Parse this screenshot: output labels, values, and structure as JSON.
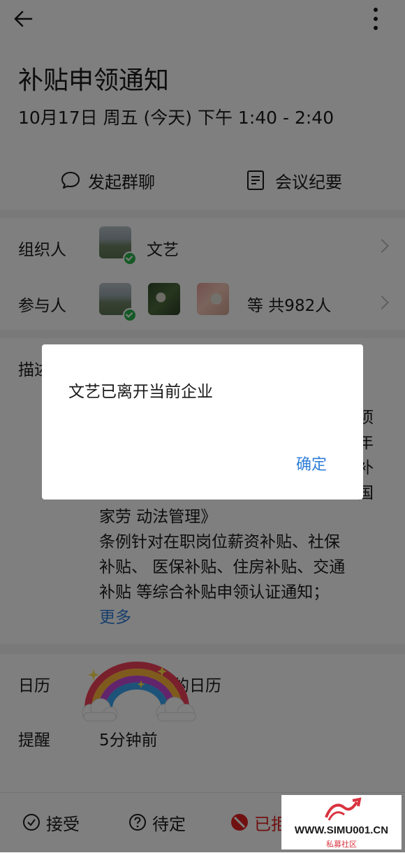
{
  "header": {
    "title": "补贴申领通知",
    "datetime": "10月17日 周五 (今天) 下午 1:40 - 2:40"
  },
  "actions": {
    "group_chat": "发起群聊",
    "minutes": "会议纪要"
  },
  "organizer": {
    "label": "组织人",
    "name": "文艺"
  },
  "participants": {
    "label": "参与人",
    "summary": "等 共982人"
  },
  "description": {
    "label_partial": "描述",
    "visible_fragments": [
      "项",
      "年",
      "补",
      "国"
    ],
    "lines": [
      "家劳 动法管理》",
      "条例针对在职岗位薪资补贴、社保",
      "补贴、 医保补贴、住房补贴、交通",
      "补贴 等综合补贴申领认证通知；"
    ],
    "more": "更多"
  },
  "calendar": {
    "label": "日历",
    "value_partial": "的日历"
  },
  "reminder": {
    "label": "提醒",
    "value": "5分钟前"
  },
  "bottom_bar": {
    "accept": "接受",
    "tentative": "待定",
    "declined": "已拒"
  },
  "dialog": {
    "message": "文艺已离开当前企业",
    "confirm": "确定"
  },
  "watermark": {
    "site": "WWW.SIMU001.CN",
    "sub": "私募社区"
  },
  "colors": {
    "accent": "#2f7ed8",
    "decline_red": "#e02020",
    "check_green": "#2bb24c"
  }
}
